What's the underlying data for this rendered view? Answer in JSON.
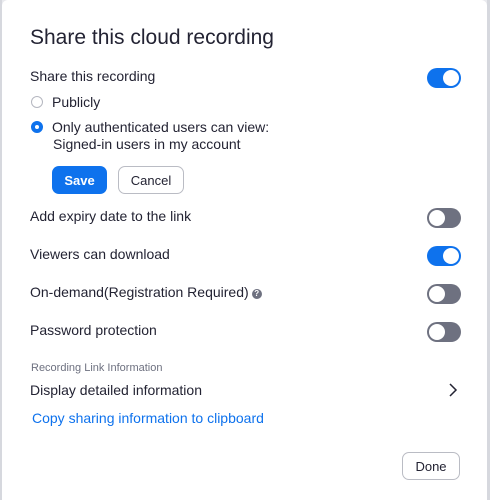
{
  "dialog": {
    "title": "Share this cloud recording"
  },
  "share_recording": {
    "label": "Share this recording",
    "enabled": true,
    "options": [
      {
        "label": "Publicly",
        "selected": false
      },
      {
        "label": "Only authenticated users can view:",
        "sublabel": "Signed-in users in my account",
        "selected": true
      }
    ],
    "save_label": "Save",
    "cancel_label": "Cancel"
  },
  "settings": {
    "expiry": {
      "label": "Add expiry date to the link",
      "enabled": false
    },
    "download": {
      "label": "Viewers can download",
      "enabled": true
    },
    "on_demand": {
      "label": "On-demand(Registration Required)",
      "enabled": false,
      "info_icon": "info-icon"
    },
    "password": {
      "label": "Password protection",
      "enabled": false
    }
  },
  "link_info": {
    "heading": "Recording Link Information",
    "detail_label": "Display detailed information",
    "copy_label": "Copy sharing information to clipboard"
  },
  "footer": {
    "done_label": "Done"
  },
  "colors": {
    "accent": "#0e72ed",
    "toggle_off": "#6e7180",
    "text": "#232333"
  }
}
